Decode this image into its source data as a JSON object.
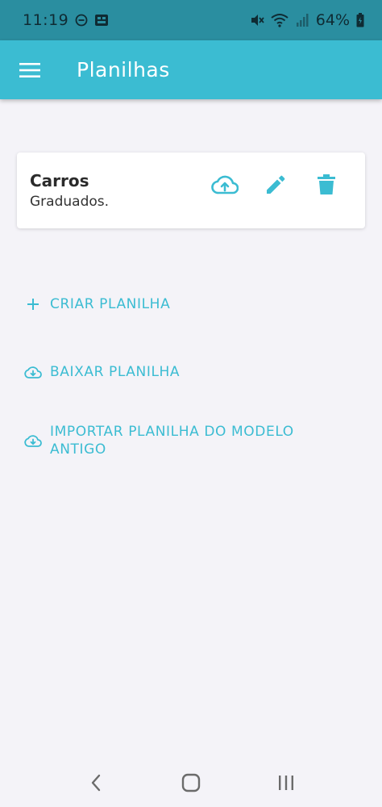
{
  "status_bar": {
    "time": "11:19",
    "battery": "64%",
    "icons": [
      "do-not-disturb-icon",
      "notification-app-icon",
      "mute-icon",
      "wifi-icon",
      "signal-icon",
      "battery-charging-icon"
    ]
  },
  "app_bar": {
    "title": "Planilhas",
    "menu_icon": "hamburger-menu-icon",
    "color": "#3bbcd2"
  },
  "spreadsheets": [
    {
      "title": "Carros",
      "subtitle": "Graduados.",
      "actions": [
        "cloud-upload-icon",
        "edit-pencil-icon",
        "trash-icon"
      ]
    }
  ],
  "actions": {
    "create": {
      "label": "CRIAR PLANILHA",
      "icon": "plus-icon"
    },
    "download": {
      "label": "BAIXAR PLANILHA",
      "icon": "cloud-download-icon"
    },
    "import_legacy": {
      "label": "IMPORTAR PLANILHA DO MODELO ANTIGO",
      "icon": "cloud-download-icon"
    }
  },
  "nav_bar": {
    "icons": [
      "back-icon",
      "home-icon",
      "recent-apps-icon"
    ]
  },
  "colors": {
    "accent": "#3bbcd2",
    "status_bar": "#2a8ea0",
    "background": "#f4f3f8"
  }
}
